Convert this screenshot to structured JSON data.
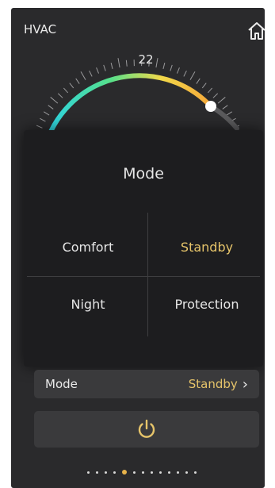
{
  "header": {
    "title": "HVAC",
    "home_icon": "home-icon"
  },
  "dial": {
    "setpoint": "22",
    "current_temp": "29",
    "gradient_colors": [
      "#2ad3e8",
      "#57e08a",
      "#f2d94a",
      "#f4a83a"
    ]
  },
  "modal": {
    "title": "Mode",
    "options": [
      {
        "label": "Comfort",
        "selected": false
      },
      {
        "label": "Standby",
        "selected": true
      },
      {
        "label": "Night",
        "selected": false
      },
      {
        "label": "Protection",
        "selected": false
      }
    ]
  },
  "mode_row": {
    "label": "Mode",
    "value": "Standby",
    "chevron_icon": "chevron-right-icon"
  },
  "power": {
    "icon": "power-icon"
  },
  "pager": {
    "count": 13,
    "active_index": 4
  },
  "colors": {
    "accent": "#e6c46a",
    "panel": "#2a2a2c",
    "modal": "#1d1d1f"
  }
}
